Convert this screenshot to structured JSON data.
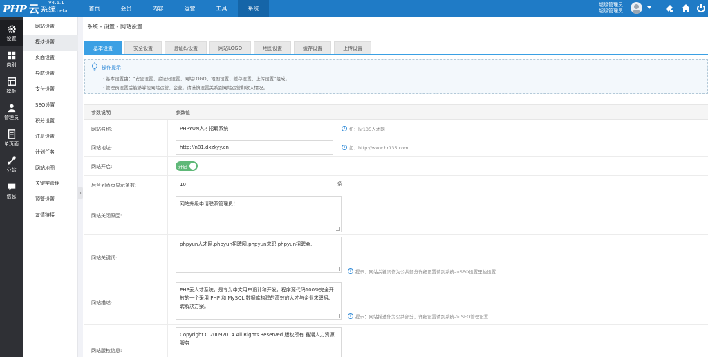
{
  "logo": {
    "php": "PHP",
    "yun": "云",
    "sys": "系统",
    "beta": "beta",
    "version": "V4.6.1"
  },
  "topnav": [
    "首页",
    "会员",
    "内容",
    "运营",
    "工具",
    "系统"
  ],
  "user": {
    "line1": "超级管理员",
    "line2": "超级管理员"
  },
  "rail": [
    {
      "label": "设置",
      "icon": "gear-icon"
    },
    {
      "label": "类别",
      "icon": "category-icon"
    },
    {
      "label": "模板",
      "icon": "template-icon"
    },
    {
      "label": "管理员",
      "icon": "admin-icon"
    },
    {
      "label": "单页面",
      "icon": "page-icon"
    },
    {
      "label": "分站",
      "icon": "substation-icon"
    },
    {
      "label": "信息",
      "icon": "message-icon"
    }
  ],
  "subside": [
    "网站设置",
    "模块设置",
    "页面设置",
    "导航设置",
    "支付设置",
    "SEO设置",
    "积分设置",
    "注册设置",
    "计划任务",
    "网站地图",
    "关键字管理",
    "预警设置",
    "友情链接"
  ],
  "breadcrumb": "系统 - 设置 - 网站设置",
  "tabs": [
    "基本设置",
    "安全设置",
    "验证码设置",
    "网站LOGO",
    "地图设置",
    "缓存设置",
    "上传设置"
  ],
  "tips": {
    "title": "操作提示",
    "line1": "基本设置由：“安全设置、验证码设置、网站LOGO、地图设置、缓存设置、上传设置”组成。",
    "line2": "管理员设置后能够掌控网站运营、企业。请谨慎设置关系到网站运营和收入情况。"
  },
  "table": {
    "col1": "参数说明",
    "col2": "参数值"
  },
  "fields": {
    "site_name": {
      "label": "网站名称:",
      "value": "PHPYUN人才招聘系统",
      "hint": "如：hr135人才网"
    },
    "site_url": {
      "label": "网站地址:",
      "value": "http://n81.dxzkyy.cn",
      "hint": "如：http://www.hr135.com"
    },
    "site_open": {
      "label": "网站开启:",
      "value": "开启"
    },
    "page_size": {
      "label": "后台列表页显示条数:",
      "value": "10",
      "unit": "条"
    },
    "close_reason": {
      "label": "网站关闭原因:",
      "value": "网站升级中请联系管理员！"
    },
    "keywords": {
      "label": "网站关键词:",
      "value": "phpyun人才网,phpyun招聘网,phpyun求职,phpyun招聘会,",
      "hint": "提示：网站关键词作为公共部分详细设置请到系统->SEO设置里独设置"
    },
    "description": {
      "label": "网站描述:",
      "value": "PHP云人才系统，是专为中文用户设计和开发，程序源代码100%完全开放的一个采用 PHP 和 MySQL 数据库构建的高效的人才与企业求职招、聘解决方案。",
      "hint": "提示：网站描述作为公共部分，详细设置请到系统-> SEO管理设置"
    },
    "copyright": {
      "label": "网站版权信息:",
      "value": "Copyright C 20092014 All Rights Reserved 版权所有 鑫潮人力资源服务"
    }
  }
}
